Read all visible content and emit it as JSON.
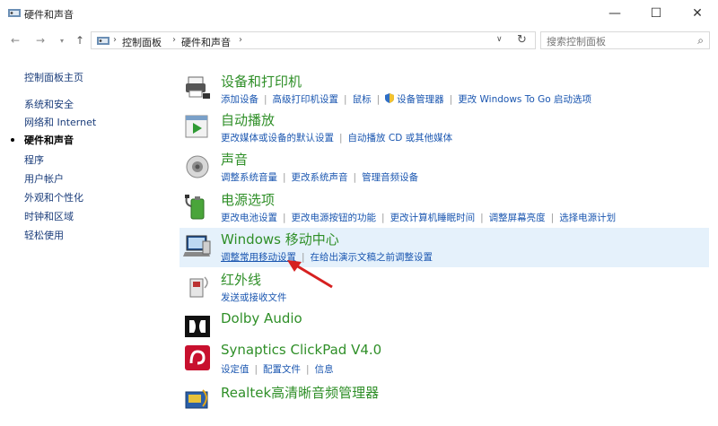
{
  "window": {
    "title": "硬件和声音",
    "minimize": "—",
    "maximize": "☐",
    "close": "✕"
  },
  "nav": {
    "back": "←",
    "forward": "→",
    "recent": "▾",
    "up": "↑"
  },
  "address": {
    "crumbs": [
      "控制面板",
      "硬件和声音"
    ],
    "separator": "›",
    "dropdown": "∨",
    "refresh": "↻"
  },
  "search": {
    "placeholder": "搜索控制面板",
    "icon": "search-icon"
  },
  "sidebar": {
    "items": [
      {
        "label": "控制面板主页"
      },
      {
        "label": "系统和安全"
      },
      {
        "label": "网络和 Internet"
      },
      {
        "label": "硬件和声音",
        "active": true
      },
      {
        "label": "程序"
      },
      {
        "label": "用户帐户"
      },
      {
        "label": "外观和个性化"
      },
      {
        "label": "时钟和区域"
      },
      {
        "label": "轻松使用"
      }
    ]
  },
  "categories": [
    {
      "title": "设备和打印机",
      "icon": "printer-icon",
      "links": [
        "添加设备",
        "高级打印机设置",
        "鼠标",
        "设备管理器",
        "更改 Windows To Go 启动选项"
      ]
    },
    {
      "title": "自动播放",
      "icon": "autoplay-icon",
      "links": [
        "更改媒体或设备的默认设置",
        "自动播放 CD 或其他媒体"
      ]
    },
    {
      "title": "声音",
      "icon": "speaker-icon",
      "links": [
        "调整系统音量",
        "更改系统声音",
        "管理音频设备"
      ]
    },
    {
      "title": "电源选项",
      "icon": "battery-icon",
      "links": [
        "更改电池设置",
        "更改电源按钮的功能",
        "更改计算机睡眠时间",
        "调整屏幕亮度",
        "选择电源计划"
      ]
    },
    {
      "title": "Windows 移动中心",
      "icon": "mobility-center-icon",
      "links": [
        "调整常用移动设置",
        "在给出演示文稿之前调整设置"
      ]
    },
    {
      "title": "红外线",
      "icon": "infrared-icon",
      "links": [
        "发送或接收文件"
      ]
    },
    {
      "title": "Dolby Audio",
      "icon": "dolby-icon",
      "links": []
    },
    {
      "title": "Synaptics ClickPad V4.0",
      "icon": "synaptics-icon",
      "links": [
        "设定值",
        "配置文件",
        "信息"
      ]
    },
    {
      "title": "Realtek高清晰音频管理器",
      "icon": "realtek-icon",
      "links": []
    }
  ],
  "colors": {
    "category_title": "#2f8f28",
    "link": "#1a56b0",
    "highlight": "#e5f1fb",
    "annotation_arrow": "#d62020"
  }
}
